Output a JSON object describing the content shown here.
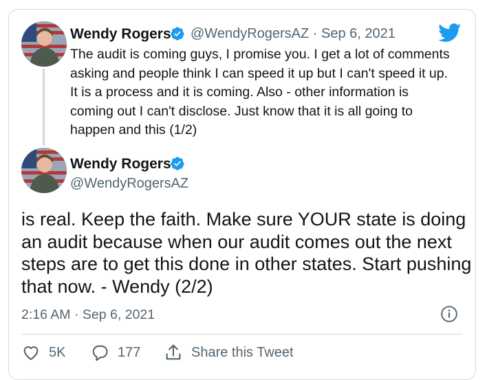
{
  "tweet1": {
    "author_name": "Wendy Rogers",
    "handle": "@WendyRogersAZ",
    "separator": "·",
    "date": "Sep 6, 2021",
    "text": "The audit is coming guys, I promise you. I get a lot of comments asking and people think I can speed it up but I can't speed it up. It is a process and it is coming. Also - other information is coming out I can't disclose. Just know that it is all going to happen and this (1/2)"
  },
  "tweet2": {
    "author_name": "Wendy Rogers",
    "handle": "@WendyRogersAZ",
    "text": "is real. Keep the faith. Make sure YOUR state is doing an audit because when our audit comes out the next steps are to get this done in other states. Start pushing that now. - Wendy (2/2)",
    "timestamp": "2:16 AM · Sep 6, 2021"
  },
  "actions": {
    "likes": "5K",
    "replies": "177",
    "share_label": "Share this Tweet"
  },
  "colors": {
    "brand_blue": "#1d9bf0",
    "text_primary": "#0f1419",
    "text_secondary": "#536471",
    "border": "#cfd9de"
  },
  "icons": {
    "brand": "twitter-bird-icon",
    "verified": "verified-badge-icon",
    "info": "info-icon",
    "like": "heart-icon",
    "reply": "reply-icon",
    "share": "share-icon"
  }
}
